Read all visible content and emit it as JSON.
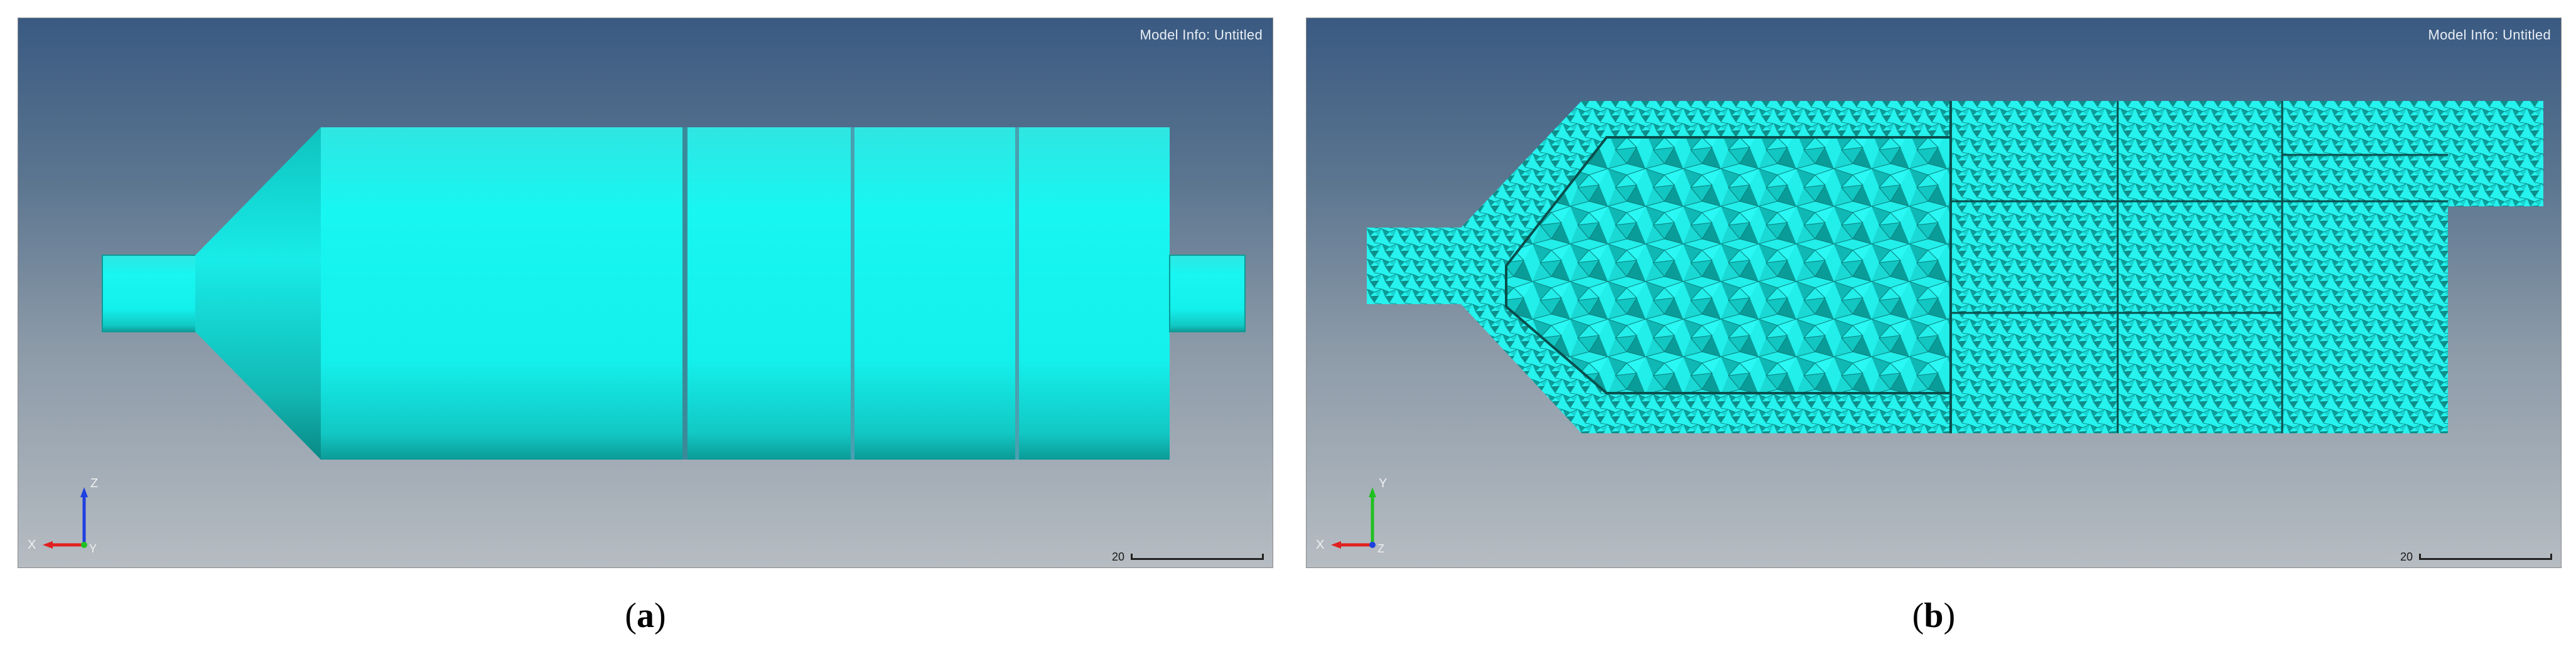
{
  "panels": [
    {
      "id": "a",
      "model_info": "Model Info: Untitled",
      "scale_label": "20",
      "triad": {
        "vertical_axis": "Z",
        "horizontal_axis": "X",
        "depth_axis": "Y"
      },
      "caption": "a"
    },
    {
      "id": "b",
      "model_info": "Model Info: Untitled",
      "scale_label": "20",
      "triad": {
        "vertical_axis": "Y",
        "horizontal_axis": "X",
        "depth_axis": "Z"
      },
      "caption": "b"
    }
  ],
  "colors": {
    "model_cyan": "#18f0ec",
    "model_shadow": "#0a8a88",
    "triad_red": "#e02020",
    "triad_blue": "#2040e0",
    "triad_green": "#20c020"
  }
}
